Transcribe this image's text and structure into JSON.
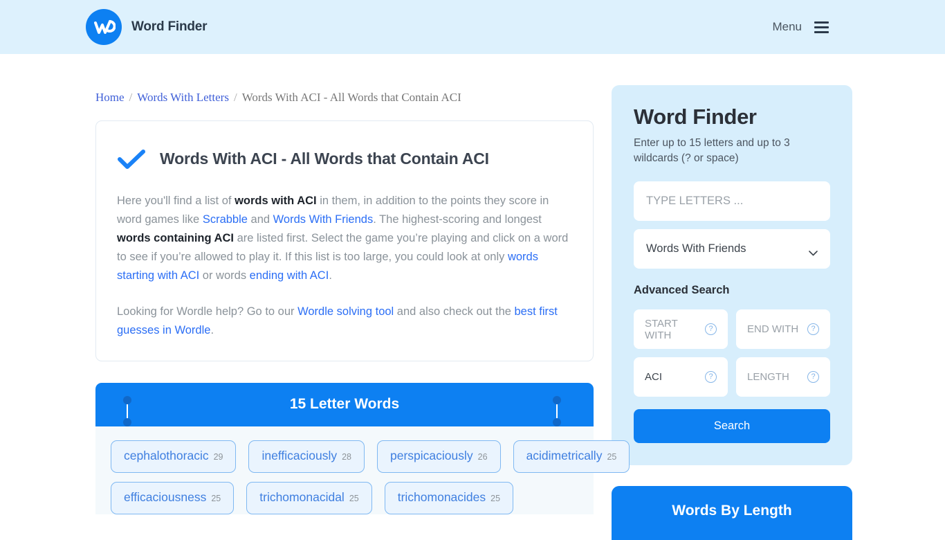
{
  "header": {
    "brand_name": "Word Finder",
    "menu_label": "Menu"
  },
  "breadcrumb": {
    "home": "Home",
    "parent": "Words With Letters",
    "current": "Words With ACI - All Words that Contain ACI",
    "separator": "/"
  },
  "intro": {
    "title": "Words With ACI - All Words that Contain ACI",
    "p1": {
      "t1": "Here you'll find a list of ",
      "b1": "words with ACI",
      "t2": " in them, in addition to the points they score in word games like ",
      "a1": "Scrabble",
      "t3": " and ",
      "a2": "Words With Friends",
      "t4": ". The highest-scoring and longest ",
      "b2": "words containing ACI",
      "t5": " are listed first. Select the game you’re playing and click on a word to see if you’re allowed to play it. If this list is too large, you could look at only ",
      "a3": "words starting with ACI",
      "t6": " or words ",
      "a4": "ending with ACI",
      "t7": "."
    },
    "p2": {
      "t1": "Looking for Wordle help? Go to our ",
      "a1": "Wordle solving tool",
      "t2": " and also check out the ",
      "a2": "best first guesses in Wordle",
      "t3": "."
    }
  },
  "words_panel": {
    "header": "15 Letter Words",
    "rows": [
      [
        {
          "word": "cephalothoracic",
          "score": "29"
        },
        {
          "word": "inefficaciously",
          "score": "28"
        },
        {
          "word": "perspicaciously",
          "score": "26"
        },
        {
          "word": "acidimetrically",
          "score": "25"
        }
      ],
      [
        {
          "word": "efficaciousness",
          "score": "25"
        },
        {
          "word": "trichomonacidal",
          "score": "25"
        },
        {
          "word": "trichomonacides",
          "score": "25"
        }
      ]
    ]
  },
  "sidebar": {
    "title": "Word Finder",
    "subtitle": "Enter up to 15 letters and up to 3 wildcards (? or space)",
    "letters_placeholder": "TYPE LETTERS ...",
    "letters_value": "",
    "game_selected": "Words With Friends",
    "advanced_title": "Advanced Search",
    "fields": [
      {
        "label": "START WITH",
        "value": "",
        "filled": false
      },
      {
        "label": "END WITH",
        "value": "",
        "filled": false
      },
      {
        "label": "ACI",
        "value": "ACI",
        "filled": true
      },
      {
        "label": "LENGTH",
        "value": "",
        "filled": false
      }
    ],
    "help_glyph": "?",
    "search_label": "Search",
    "words_by_length_title": "Words By Length"
  },
  "colors": {
    "accent": "#0d80f2",
    "header_bg": "#ddf1fd",
    "panel_bg": "#d7eefc",
    "link": "#2b6ef5",
    "chip_border": "#7fb8f2",
    "chip_bg": "#eaf4fe"
  }
}
